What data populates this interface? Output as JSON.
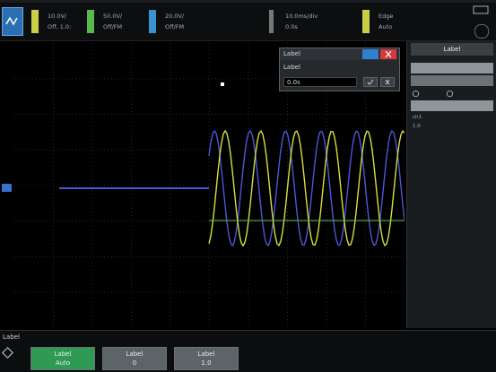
{
  "top_bar": {
    "channels": [
      {
        "line1": "10.0V/",
        "line2": "Off, 1.0:",
        "color": "#d9e14a"
      },
      {
        "line1": "50.0V/",
        "line2": "Off/FM",
        "color": "#56c24a"
      },
      {
        "line1": "20.0V/",
        "line2": "Off/FM",
        "color": "#3c9bd8"
      }
    ],
    "timebase_line1": "10.0ms/div",
    "timebase_line2": "0.0s",
    "trigger_line1": "Edge",
    "trigger_line2": "Auto"
  },
  "dialog": {
    "title": "Label",
    "label": "Label",
    "value": "0.0s",
    "ok": "OK",
    "cancel": "Cancel"
  },
  "right_panel": {
    "header": "Label",
    "rows": [
      {
        "k": "ch1",
        "v": ""
      },
      {
        "k": "1.0",
        "v": ""
      }
    ]
  },
  "bottom_bar": {
    "section_label": "Label",
    "softkeys": [
      {
        "line1": "Label",
        "line2": "Auto",
        "active": true
      },
      {
        "line1": "Label",
        "line2": "0",
        "active": false
      },
      {
        "line1": "Label",
        "line2": "1.0",
        "active": false
      }
    ]
  },
  "colors": {
    "ch1": "#d6df3d",
    "ch2": "#58c44a",
    "ch3": "#4b57d6",
    "grid": "#1f2a2f",
    "screen_bg": "#000000"
  },
  "waveform": {
    "flat_before_trigger": true,
    "sine_cycles": 5.5
  }
}
